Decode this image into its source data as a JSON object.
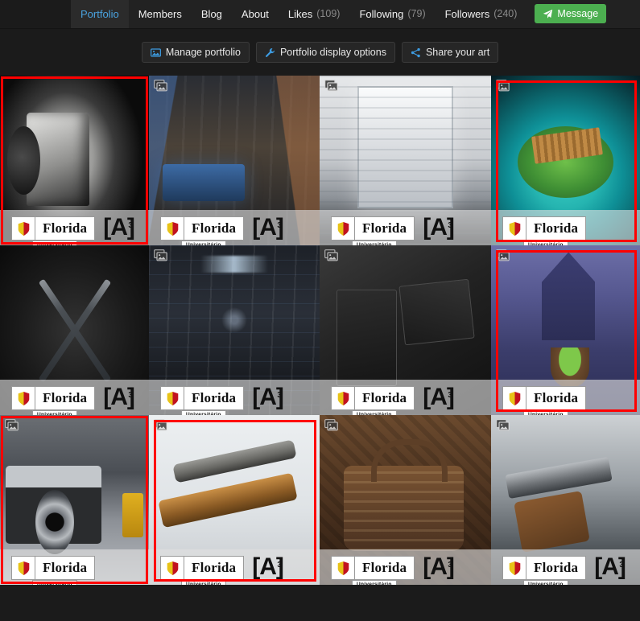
{
  "nav": {
    "tabs": [
      {
        "label": "Portfolio",
        "count": null,
        "active": true,
        "name": "tab-portfolio"
      },
      {
        "label": "Members",
        "count": null,
        "active": false,
        "name": "tab-members"
      },
      {
        "label": "Blog",
        "count": null,
        "active": false,
        "name": "tab-blog"
      },
      {
        "label": "About",
        "count": null,
        "active": false,
        "name": "tab-about"
      },
      {
        "label": "Likes",
        "count": "(109)",
        "active": false,
        "name": "tab-likes"
      },
      {
        "label": "Following",
        "count": "(79)",
        "active": false,
        "name": "tab-following"
      },
      {
        "label": "Followers",
        "count": "(240)",
        "active": false,
        "name": "tab-followers"
      }
    ],
    "message_button": {
      "label": "Message",
      "icon": "paper-plane-icon",
      "color": "#4caf50"
    }
  },
  "actionbar": {
    "buttons": [
      {
        "label": "Manage portfolio",
        "icon": "image-icon",
        "name": "manage-portfolio-button"
      },
      {
        "label": "Portfolio display options",
        "icon": "wrench-icon",
        "name": "portfolio-display-options-button"
      },
      {
        "label": "Share your art",
        "icon": "share-icon",
        "name": "share-your-art-button"
      }
    ]
  },
  "watermark": {
    "name": "Florida",
    "subtitle": "Universitário",
    "mark": "[A]",
    "mark_sup": "3"
  },
  "gallery": {
    "selection_color": "#ff0000",
    "stack_icon": "image-stack-icon",
    "rows": [
      [
        {
          "name": "thumb-lighter-dark",
          "art": "bg-lighter-dark",
          "selected": true,
          "stack": false,
          "mark": true,
          "extra": ""
        },
        {
          "name": "thumb-scifi-lounge",
          "art": "bg-scifi-lounge",
          "selected": false,
          "stack": true,
          "mark": true,
          "extra": ""
        },
        {
          "name": "thumb-white-corridor",
          "art": "bg-white-corridor",
          "selected": false,
          "stack": true,
          "mark": true,
          "extra": ""
        },
        {
          "name": "thumb-isle-bridge",
          "art": "bg-isle-bridge",
          "selected": true,
          "stack": true,
          "mark": false,
          "extra": ""
        }
      ],
      [
        {
          "name": "thumb-crossed-axes",
          "art": "bg-axes",
          "selected": false,
          "stack": false,
          "mark": true,
          "extra": ""
        },
        {
          "name": "thumb-ship-corridor",
          "art": "bg-ship-corridor",
          "selected": false,
          "stack": true,
          "mark": true,
          "extra": ""
        },
        {
          "name": "thumb-engraved-lighter",
          "art": "bg-engraved",
          "selected": false,
          "stack": true,
          "mark": true,
          "extra": ""
        },
        {
          "name": "thumb-halloween",
          "art": "bg-halloween",
          "selected": true,
          "stack": true,
          "mark": false,
          "extra": ""
        }
      ],
      [
        {
          "name": "thumb-vintage-camera",
          "art": "bg-camera",
          "selected": true,
          "stack": true,
          "mark": false,
          "extra": "film-strip"
        },
        {
          "name": "thumb-scoped-rifle",
          "art": "bg-rifle",
          "selected": true,
          "stack": true,
          "mark": true,
          "extra": ""
        },
        {
          "name": "thumb-monogram-bag",
          "art": "bg-bag",
          "selected": false,
          "stack": true,
          "mark": true,
          "extra": ""
        },
        {
          "name": "thumb-revolver",
          "art": "bg-revolver",
          "selected": false,
          "stack": true,
          "mark": true,
          "extra": ""
        }
      ]
    ]
  }
}
